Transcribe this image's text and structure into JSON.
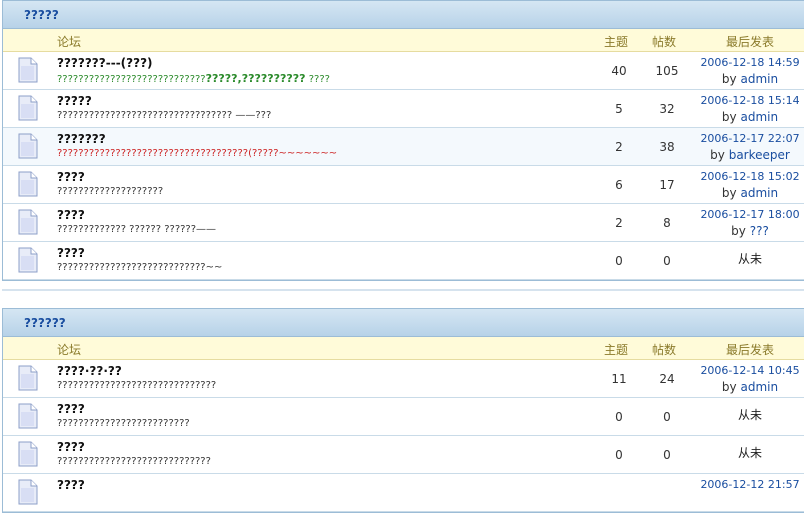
{
  "columns": {
    "forum": "论坛",
    "topics": "主题",
    "posts": "帖数",
    "last": "最后发表"
  },
  "by_prefix": "by ",
  "categories": [
    {
      "title": "?????",
      "forums": [
        {
          "name": "???????---(???)",
          "desc": "????????????????????????????",
          "desc_bold": "?????,??????????",
          "desc_tail": " ????",
          "desc_color": "#2a8a2a",
          "topics": "40",
          "posts": "105",
          "date": "2006-12-18 14:59",
          "user": "admin"
        },
        {
          "name": "?????",
          "desc": "????????????????????????????????? ——???",
          "desc_color": "#333333",
          "topics": "5",
          "posts": "32",
          "date": "2006-12-18 15:14",
          "user": "admin"
        },
        {
          "name": "???????",
          "desc": "??????",
          "desc_rest": "??????????????????????????????(?????~~~~~~~",
          "desc_color": "#cc2222",
          "topics": "2",
          "posts": "38",
          "date": "2006-12-17 22:07",
          "user": "barkeeper"
        },
        {
          "name": "????",
          "desc": "????????????????????",
          "desc_color": "#333333",
          "topics": "6",
          "posts": "17",
          "date": "2006-12-18 15:02",
          "user": "admin"
        },
        {
          "name": "????",
          "desc": "????????????? ?????? ??????——",
          "desc_color": "#333333",
          "topics": "2",
          "posts": "8",
          "date": "2006-12-17 18:00",
          "user": "???"
        },
        {
          "name": "????",
          "desc": "????????????????",
          "desc_rest": "????????????~~",
          "desc_color": "#333333",
          "topics": "0",
          "posts": "0",
          "never": "从未"
        }
      ]
    },
    {
      "title": "??????",
      "forums": [
        {
          "name": "????·??·??",
          "desc": "??????????????????????????????",
          "desc_color": "#333333",
          "topics": "11",
          "posts": "24",
          "date": "2006-12-14 10:45",
          "user": "admin"
        },
        {
          "name": "????",
          "desc": "?????????????????????????",
          "desc_color": "#333333",
          "topics": "0",
          "posts": "0",
          "never": "从未"
        },
        {
          "name": "????",
          "desc": "?????????????????????????????",
          "desc_color": "#333333",
          "topics": "0",
          "posts": "0",
          "never": "从未"
        },
        {
          "name": "????",
          "date": "2006-12-12 21:57"
        }
      ]
    }
  ]
}
